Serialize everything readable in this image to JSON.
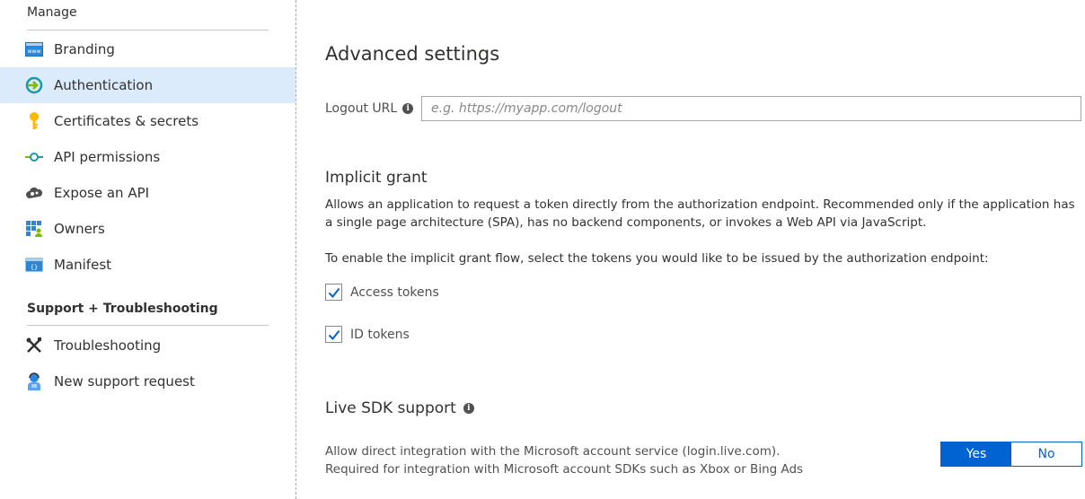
{
  "sidebar": {
    "manage_title": "Manage",
    "items": [
      {
        "label": "Branding",
        "icon": "branding-icon"
      },
      {
        "label": "Authentication",
        "icon": "authentication-icon",
        "active": true
      },
      {
        "label": "Certificates & secrets",
        "icon": "key-icon"
      },
      {
        "label": "API permissions",
        "icon": "api-permissions-icon"
      },
      {
        "label": "Expose an API",
        "icon": "cloud-api-icon"
      },
      {
        "label": "Owners",
        "icon": "owners-icon"
      },
      {
        "label": "Manifest",
        "icon": "manifest-icon"
      }
    ],
    "support_title": "Support + Troubleshooting",
    "support_items": [
      {
        "label": "Troubleshooting",
        "icon": "wrench-icon"
      },
      {
        "label": "New support request",
        "icon": "support-person-icon"
      }
    ]
  },
  "main": {
    "title": "Advanced settings",
    "logout": {
      "label": "Logout URL",
      "placeholder": "e.g. https://myapp.com/logout",
      "value": ""
    },
    "implicit": {
      "title": "Implicit grant",
      "description": "Allows an application to request a token directly from the authorization endpoint. Recommended only if the application has a single page architecture (SPA), has no backend components, or invokes a Web API via JavaScript.",
      "instruction": "To enable the implicit grant flow, select the tokens you would like to be issued by the authorization endpoint:",
      "options": [
        {
          "label": "Access tokens",
          "checked": true
        },
        {
          "label": "ID tokens",
          "checked": true
        }
      ]
    },
    "live_sdk": {
      "title": "Live SDK support",
      "line1": "Allow direct integration with the Microsoft account service (login.live.com).",
      "line2": "Required for integration with Microsoft account SDKs such as Xbox or Bing Ads",
      "yes_label": "Yes",
      "no_label": "No",
      "selected": "Yes"
    }
  },
  "colors": {
    "accent": "#0063d1",
    "active_nav_bg": "#dcebfb"
  }
}
